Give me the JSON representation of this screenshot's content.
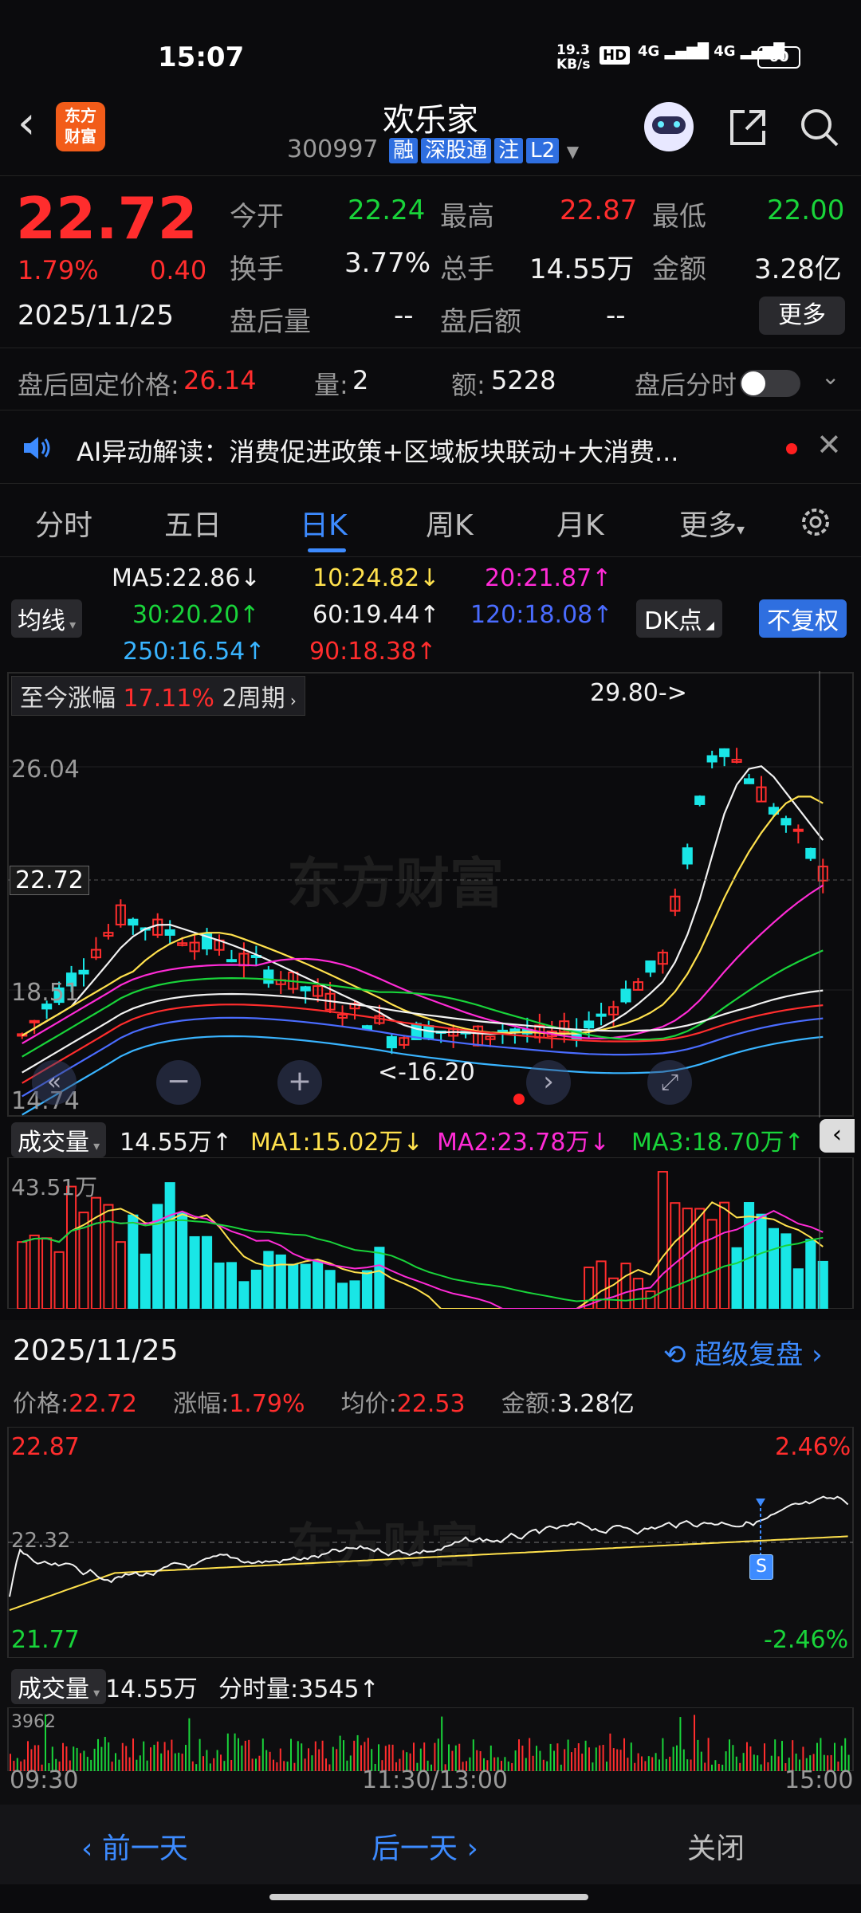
{
  "status_bar": {
    "time": "15:07",
    "net_speed_top": "19.3",
    "net_speed_bottom": "KB/s",
    "hd": "HD",
    "sig1": "4G",
    "sig2": "4G",
    "battery": "60"
  },
  "header": {
    "title": "欢乐家",
    "code": "300997",
    "tags": [
      "融",
      "深股通",
      "注",
      "L2"
    ],
    "app_logo_top": "东方",
    "app_logo_bottom": "财富"
  },
  "quote": {
    "price": "22.72",
    "change_pct": "1.79%",
    "change_amt": "0.40",
    "date": "2025/11/25",
    "open_label": "今开",
    "open": "22.24",
    "high_label": "最高",
    "high": "22.87",
    "low_label": "最低",
    "low": "22.00",
    "turnover_label": "换手",
    "turnover": "3.77%",
    "volume_label": "总手",
    "volume": "14.55万",
    "amount_label": "金额",
    "amount": "3.28亿",
    "after_vol_label": "盘后量",
    "after_vol": "--",
    "after_amt_label": "盘后额",
    "after_amt": "--",
    "more_label": "更多"
  },
  "after_hours": {
    "price_label": "盘后固定价格:",
    "price": "26.14",
    "qty_label": "量:",
    "qty": "2",
    "amt_label": "额:",
    "amt": "5228",
    "toggle_label": "盘后分时"
  },
  "news": {
    "text": "AI异动解读：消费促进政策+区域板块联动+大消费..."
  },
  "tabs": {
    "items": [
      "分时",
      "五日",
      "日K",
      "周K",
      "月K",
      "更多"
    ],
    "active": 2
  },
  "ma_legend": {
    "selector": "均线",
    "row1": {
      "ma5": "MA5:22.86↓",
      "ma10": "10:24.82↓",
      "ma20": "20:21.87↑"
    },
    "row2": {
      "ma30": "30:20.20↑",
      "ma60": "60:19.44↑",
      "ma120": "120:18.08↑"
    },
    "row3": {
      "ma250": "250:16.54↑",
      "ma90": "90:18.38↑"
    },
    "dk_btn": "DK点",
    "fq_btn": "不复权"
  },
  "kline": {
    "range_label": "至今涨幅",
    "range_value": "17.11%",
    "period": "2周期",
    "y_top": "26.04",
    "y_mid": "18.51",
    "y_bottom": "14.74",
    "cur_price": "22.72",
    "high_mark": "29.80->",
    "low_mark": "<-16.20"
  },
  "volume_panel": {
    "label": "成交量",
    "value": "14.55万↑",
    "ma1": "MA1:15.02万↓",
    "ma2": "MA2:23.78万↓",
    "ma3": "MA3:18.70万↑",
    "ymax": "43.51万"
  },
  "intraday": {
    "date": "2025/11/25",
    "replay": "超级复盘",
    "price_label": "价格:",
    "price": "22.72",
    "chg_label": "涨幅:",
    "chg": "1.79%",
    "avg_label": "均价:",
    "avg": "22.53",
    "amt_label": "金额:",
    "amt": "3.28亿",
    "y_top": "22.87",
    "y_mid": "22.32",
    "y_bottom": "21.77",
    "pct_top": "2.46%",
    "pct_bottom": "-2.46%",
    "s_mark": "S",
    "vol_label": "成交量",
    "vol": "14.55万",
    "tick_label": "分时量:3545↑",
    "vol_max": "3962",
    "t_start": "09:30",
    "t_mid": "11:30/13:00",
    "t_end": "15:00"
  },
  "bottom_nav": {
    "prev": "前一天",
    "next": "后一天",
    "close": "关闭"
  },
  "colors": {
    "up": "#ff2d2d",
    "down": "#19d43a",
    "accent": "#3d8bff",
    "bg": "#0b0b0d"
  }
}
